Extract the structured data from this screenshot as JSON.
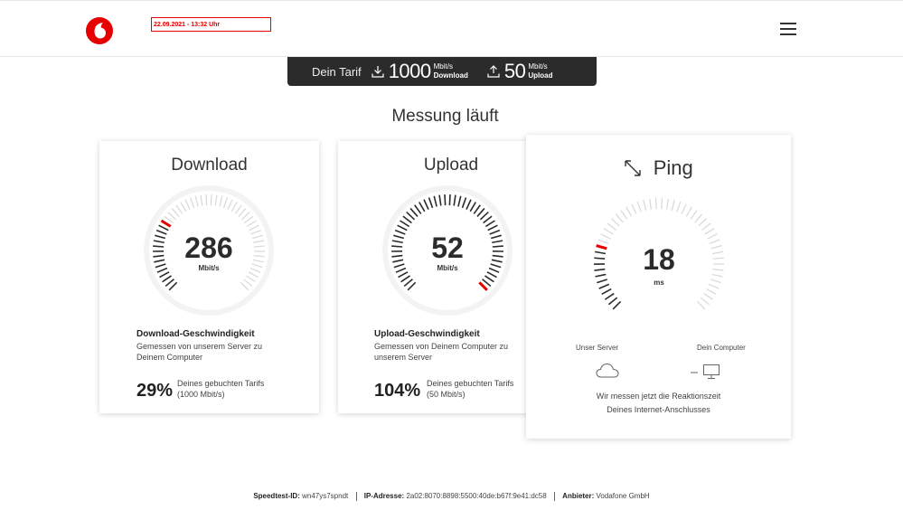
{
  "header": {
    "datetime": "22.09.2021 - 13:32 Uhr",
    "brand_color": "#e60000"
  },
  "tarif": {
    "label": "Dein Tarif",
    "download_value": "1000",
    "download_unit": "Mbit/s",
    "download_label": "Download",
    "upload_value": "50",
    "upload_unit": "Mbit/s",
    "upload_label": "Upload"
  },
  "title": "Messung läuft",
  "download": {
    "title": "Download",
    "value": "286",
    "unit": "Mbit/s",
    "info_title": "Download-Geschwindigkeit",
    "info_desc": "Gemessen von unserem Server zu Deinem Computer",
    "percent": "29%",
    "percent_desc_1": "Deines gebuchten Tarifs",
    "percent_desc_2": "(1000 Mbit/s)",
    "fill_fraction": 0.29
  },
  "upload": {
    "title": "Upload",
    "value": "52",
    "unit": "Mbit/s",
    "info_title": "Upload-Geschwindigkeit",
    "info_desc": "Gemessen von Deinem Computer zu unserem Server",
    "percent": "104%",
    "percent_desc_1": "Deines gebuchten Tarifs",
    "percent_desc_2": "(50 Mbit/s)",
    "fill_fraction": 1.0
  },
  "ping": {
    "title": "Ping",
    "value": "18",
    "unit": "ms",
    "server_label": "Unser Server",
    "computer_label": "Dein Computer",
    "desc_1": "Wir messen jetzt die Reaktionszeit",
    "desc_2": "Deines Internet-Anschlusses",
    "fill_fraction": 0.23
  },
  "footer": {
    "id_label": "Speedtest-ID:",
    "id_value": "wn47ys7spndt",
    "ip_label": "IP-Adresse:",
    "ip_value": "2a02:8070:8898:5500:40de:b67f:9e41:dc58",
    "provider_label": "Anbieter:",
    "provider_value": "Vodafone GmbH"
  }
}
